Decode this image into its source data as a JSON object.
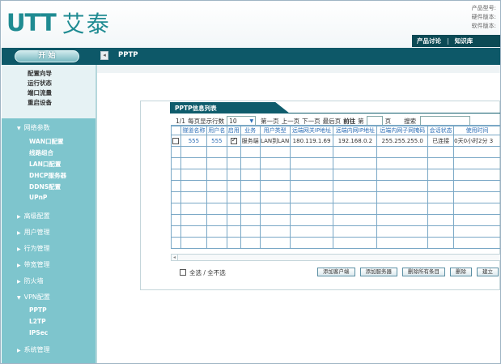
{
  "header": {
    "logo_mark": "UTT",
    "logo_text": "艾泰",
    "info_lines": [
      "产品型号:",
      "硬件版本:",
      "软件版本:"
    ],
    "nav": [
      "产品讨论",
      "知识库"
    ]
  },
  "titlebar": {
    "start_label": "开 始",
    "collapse_icon": "◂",
    "page_title": "PPTP"
  },
  "sidebar": {
    "top_items": [
      "配置向导",
      "运行状态",
      "端口流量",
      "重启设备"
    ],
    "groups": [
      {
        "label": "网络参数",
        "expanded": true,
        "items": [
          "WAN口配置",
          "线路组合",
          "LAN口配置",
          "DHCP服务器",
          "DDNS配置",
          "UPnP"
        ]
      },
      {
        "label": "高级配置",
        "expanded": false,
        "items": []
      },
      {
        "label": "用户管理",
        "expanded": false,
        "items": []
      },
      {
        "label": "行为管理",
        "expanded": false,
        "items": []
      },
      {
        "label": "带宽管理",
        "expanded": false,
        "items": []
      },
      {
        "label": "防火墙",
        "expanded": false,
        "items": []
      },
      {
        "label": "VPN配置",
        "expanded": true,
        "items": [
          "PPTP",
          "L2TP",
          "IPSec"
        ]
      },
      {
        "label": "系统管理",
        "expanded": false,
        "items": []
      }
    ]
  },
  "panel": {
    "tab_title": "PPTP信息列表",
    "pager": {
      "page_info": "1/1",
      "rows_label": "每页显示行数",
      "rows_value": "10",
      "first": "第一页",
      "prev": "上一页",
      "next": "下一页",
      "last": "最后页",
      "goto": "前往",
      "page_prefix": "第",
      "page_suffix": "页",
      "search": "搜索"
    },
    "columns": [
      "",
      "隧道名称",
      "用户名",
      "启用",
      "业务",
      "用户类型",
      "远端网关IP地址",
      "远端内网IP地址",
      "远端内网子网掩码",
      "会话状态",
      "使用时间"
    ],
    "rows": [
      {
        "checked": false,
        "tunnel": "555",
        "user": "555",
        "enabled": true,
        "service": "服务端",
        "user_type": "LAN到LAN",
        "gateway_ip": "180.119.1.69",
        "remote_ip": "192.168.0.2",
        "netmask": "255.255.255.0",
        "status": "已连接",
        "time": "0天0小时2分 3"
      }
    ],
    "empty_rows": 9,
    "select_all": "全选 / 全不选",
    "buttons": [
      "添加客户端",
      "添加服务器",
      "删除所有条目",
      "删除",
      "建立"
    ]
  },
  "colors": {
    "brand": "#1f8b92",
    "titlebar": "#0d5868",
    "sidebar": "#7ec5cd",
    "table_text": "#2d6fb7"
  }
}
